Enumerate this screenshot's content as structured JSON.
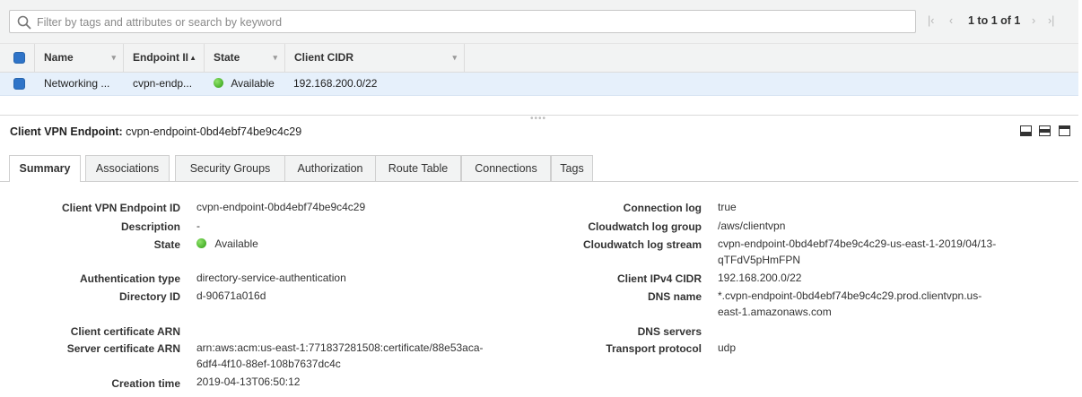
{
  "filter": {
    "placeholder": "Filter by tags and attributes or search by keyword",
    "pager_text": "1 to 1 of 1",
    "first_glyph": "|‹",
    "prev_glyph": "‹",
    "next_glyph": "›",
    "last_glyph": "›|"
  },
  "table": {
    "columns": [
      "Name",
      "Endpoint II",
      "State",
      "Client CIDR"
    ],
    "sort_indicator": "▲",
    "dropdown_indicator": "▾",
    "rows": [
      {
        "name": "Networking ...",
        "endpoint_id": "cvpn-endp...",
        "state": "Available",
        "client_cidr": "192.168.200.0/22"
      }
    ]
  },
  "detail": {
    "title_label": "Client VPN Endpoint:",
    "title_value": "cvpn-endpoint-0bd4ebf74be9c4c29",
    "grip": "••••",
    "tabs": [
      "Summary",
      "Associations",
      "Security Groups",
      "Authorization",
      "Route Table",
      "Connections",
      "Tags"
    ],
    "active_tab": "Summary",
    "left_fields": [
      {
        "label": "Client VPN Endpoint ID",
        "value": "cvpn-endpoint-0bd4ebf74be9c4c29"
      },
      {
        "label": "Description",
        "value": "-"
      },
      {
        "label": "State",
        "value": "Available"
      },
      {
        "label": "Authentication type",
        "value": "directory-service-authentication"
      },
      {
        "label": "Directory ID",
        "value": "d-90671a016d"
      },
      {
        "label": "Client certificate ARN",
        "value": ""
      },
      {
        "label": "Server certificate ARN",
        "value": "arn:aws:acm:us-east-1:771837281508:certificate/88e53aca-",
        "value2": "6df4-4f10-88ef-108b7637dc4c"
      },
      {
        "label": "Creation time",
        "value": "2019-04-13T06:50:12"
      }
    ],
    "right_fields": [
      {
        "label": "Connection log",
        "value": "true"
      },
      {
        "label": "Cloudwatch log group",
        "value": "/aws/clientvpn"
      },
      {
        "label": "Cloudwatch log stream",
        "value": "cvpn-endpoint-0bd4ebf74be9c4c29-us-east-1-2019/04/13-",
        "value2": "qTFdV5pHmFPN"
      },
      {
        "label": "Client IPv4 CIDR",
        "value": "192.168.200.0/22"
      },
      {
        "label": "DNS name",
        "value": "*.cvpn-endpoint-0bd4ebf74be9c4c29.prod.clientvpn.us-",
        "value2": "east-1.amazonaws.com"
      },
      {
        "label": "DNS servers",
        "value": ""
      },
      {
        "label": "Transport protocol",
        "value": "udp"
      }
    ]
  },
  "colors": {
    "accent": "#2f74c8",
    "selected_row": "#e6f0fb",
    "status_available": "#2d9d12"
  }
}
